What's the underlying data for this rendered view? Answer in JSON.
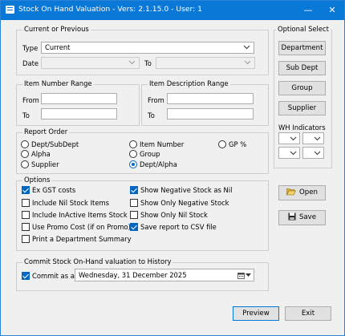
{
  "window": {
    "title": "Stock On Hand Valuation - Vers: 2.1.15.0   - User: 1"
  },
  "current_or_previous": {
    "legend": "Current or Previous",
    "type_label": "Type",
    "type_value": "Current",
    "date_label": "Date",
    "date_value": "",
    "to_label": "To",
    "to_value": ""
  },
  "item_number_range": {
    "legend": "Item Number Range",
    "from_label": "From",
    "to_label": "To",
    "from_value": "",
    "to_value": ""
  },
  "item_description_range": {
    "legend": "Item Description Range",
    "from_label": "From",
    "to_label": "To",
    "from_value": "",
    "to_value": ""
  },
  "report_order": {
    "legend": "Report Order",
    "options": [
      {
        "label": "Dept/SubDept",
        "selected": false
      },
      {
        "label": "Item Number",
        "selected": false
      },
      {
        "label": "GP %",
        "selected": false
      },
      {
        "label": "Alpha",
        "selected": false
      },
      {
        "label": "Group",
        "selected": false
      },
      {
        "label": "Supplier",
        "selected": false
      },
      {
        "label": "Dept/Alpha",
        "selected": true
      }
    ]
  },
  "options": {
    "legend": "Options",
    "items": [
      {
        "label": "Ex GST costs",
        "checked": true
      },
      {
        "label": "Include Nil Stock Items",
        "checked": false
      },
      {
        "label": "Include InActive Items Stock",
        "checked": false
      },
      {
        "label": "Use Promo Cost (if on Promo)",
        "checked": false
      },
      {
        "label": "Print a Department Summary",
        "checked": false
      },
      {
        "label": "Show Negative Stock as Nil",
        "checked": true
      },
      {
        "label": "Show Only Negative Stock",
        "checked": false
      },
      {
        "label": "Show Only Nil Stock",
        "checked": false
      },
      {
        "label": "Save report to CSV file",
        "checked": true
      }
    ]
  },
  "commit": {
    "legend": "Commit Stock On-Hand valuation to History",
    "checkbox_label": "Commit as at:",
    "checked": true,
    "date_value": "Wednesday, 31 December 2025"
  },
  "optional_select": {
    "legend": "Optional Select",
    "buttons": [
      "Department",
      "Sub Dept",
      "Group",
      "Supplier"
    ],
    "wh_label": "WH Indicators"
  },
  "actions": {
    "open": "Open",
    "save": "Save",
    "preview": "Preview",
    "exit": "Exit"
  },
  "colors": {
    "titlebar": "#0a78d7",
    "accent": "#0067c0",
    "face": "#f0f0f0"
  },
  "icons": [
    "app-icon",
    "minimize-icon",
    "close-icon",
    "folder-open-icon",
    "floppy-disk-icon",
    "calendar-icon",
    "chevron-down-icon"
  ]
}
